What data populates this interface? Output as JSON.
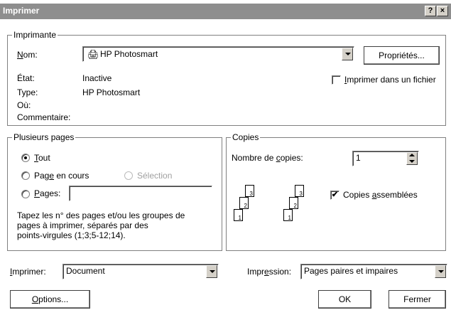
{
  "titlebar": {
    "title": "Imprimer",
    "help": "?",
    "close": "×"
  },
  "printer": {
    "legend": "Imprimante",
    "name_label": "Nom:",
    "name_value": "HP Photosmart",
    "properties_button": "Propriétés...",
    "state_label": "État:",
    "state_value": "Inactive",
    "type_label": "Type:",
    "type_value": "HP Photosmart",
    "where_label": "Où:",
    "comment_label": "Commentaire:",
    "print_to_file_label": "Imprimer dans un fichier",
    "print_to_file_checked": false
  },
  "pages": {
    "legend": "Plusieurs pages",
    "all_label": "Tout",
    "current_label": "Page en cours",
    "selection_label": "Sélection",
    "pages_label": "Pages:",
    "pages_value": "",
    "help_line1": "Tapez les n° des pages et/ou les groupes de",
    "help_line2": "pages à imprimer, séparés par des",
    "help_line3": "points-virgules (1;3;5-12;14).",
    "selected": "all"
  },
  "copies": {
    "legend": "Copies",
    "count_label": "Nombre de copies:",
    "count_value": "1",
    "collate_label": "Copies assemblées",
    "collate_checked": true
  },
  "bottom": {
    "print_what_label": "Imprimer:",
    "print_what_value": "Document",
    "print_range_label": "Impression:",
    "print_range_value": "Pages paires et impaires",
    "options_button": "Options...",
    "ok_button": "OK",
    "cancel_button": "Fermer"
  }
}
